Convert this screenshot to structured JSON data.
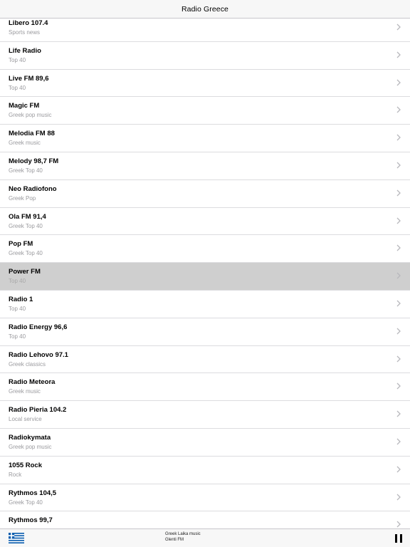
{
  "header": {
    "title": "Radio Greece"
  },
  "stations": [
    {
      "name": "Libero 107.4",
      "genre": "Sports news"
    },
    {
      "name": "Life Radio",
      "genre": "Top 40"
    },
    {
      "name": "Live FM 89,6",
      "genre": "Top 40"
    },
    {
      "name": "Magic FM",
      "genre": "Greek pop music"
    },
    {
      "name": "Melodia FM 88",
      "genre": "Greek music"
    },
    {
      "name": "Melody 98,7 FM",
      "genre": "Greek Top 40"
    },
    {
      "name": "Neo Radiofono",
      "genre": "Greek Pop"
    },
    {
      "name": "Ola FM 91,4",
      "genre": "Greek Top 40"
    },
    {
      "name": "Pop FM",
      "genre": "Greek Top 40"
    },
    {
      "name": "Power FM",
      "genre": "Top 40"
    },
    {
      "name": "Radio 1",
      "genre": "Top 40"
    },
    {
      "name": "Radio Energy 96,6",
      "genre": "Top 40"
    },
    {
      "name": "Radio Lehovo 97.1",
      "genre": "Greek classics"
    },
    {
      "name": "Radio Meteora",
      "genre": "Greek music"
    },
    {
      "name": "Radio Pieria 104.2",
      "genre": "Local service"
    },
    {
      "name": "Radiokymata",
      "genre": "Greek pop music"
    },
    {
      "name": "1055 Rock",
      "genre": "Rock"
    },
    {
      "name": "Rythmos 104,5",
      "genre": "Greek Top 40"
    },
    {
      "name": "Rythmos 99,7",
      "genre": ""
    }
  ],
  "selected_station": "Power FM",
  "player": {
    "line1": "Greek Laika music",
    "line2": "Glenti FM",
    "flag_icon": "greece-flag-icon",
    "pause_icon": "pause-icon"
  },
  "colors": {
    "selected_row": "#cfcfcf",
    "subtitle": "#9a9a9e",
    "bar_background": "#f7f7f7",
    "flag_blue": "#0d5eaf"
  }
}
